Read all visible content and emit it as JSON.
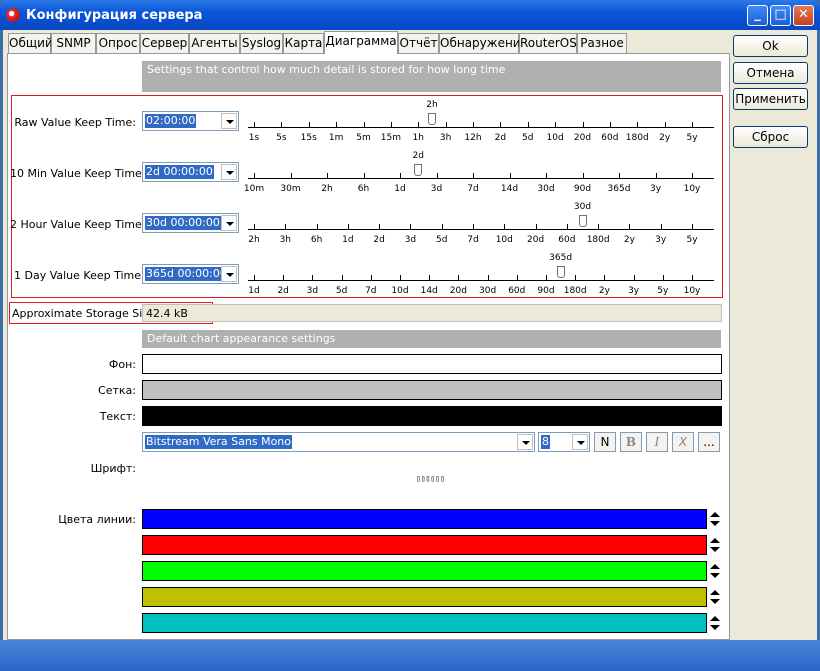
{
  "window": {
    "title": "Конфигурация сервера",
    "minimize": "_",
    "maximize": "□",
    "close": "✕"
  },
  "tabs": [
    "Общий",
    "SNMP",
    "Опрос",
    "Сервер",
    "Агенты",
    "Syslog",
    "Карта",
    "Диаграмма",
    "Отчёт",
    "Обнаружение",
    "RouterOS",
    "Разное"
  ],
  "active_tab": "Диаграмма",
  "buttons": {
    "ok": "Ok",
    "cancel": "Отмена",
    "apply": "Применить",
    "reset": "Сброс"
  },
  "retention": {
    "header": "Settings that control how much detail is stored for how long time",
    "rows": [
      {
        "label": "Raw Value Keep Time:",
        "value": "02:00:00",
        "thumb_label": "2h",
        "thumb_index": 7,
        "ticks": [
          "1s",
          "5s",
          "15s",
          "1m",
          "5m",
          "15m",
          "1h",
          "3h",
          "12h",
          "2d",
          "5d",
          "10d",
          "20d",
          "60d",
          "180d",
          "2y",
          "5y"
        ]
      },
      {
        "label": "10 Min Value Keep Time:",
        "value": "2d 00:00:00",
        "thumb_label": "2d",
        "thumb_index": 5,
        "ticks": [
          "10m",
          "30m",
          "2h",
          "6h",
          "1d",
          "3d",
          "7d",
          "14d",
          "30d",
          "90d",
          "365d",
          "3y",
          "10y"
        ]
      },
      {
        "label": "2 Hour Value Keep Time:",
        "value": "30d 00:00:00",
        "thumb_label": "30d",
        "thumb_index": 11,
        "ticks": [
          "2h",
          "3h",
          "6h",
          "1d",
          "2d",
          "3d",
          "5d",
          "7d",
          "10d",
          "20d",
          "60d",
          "180d",
          "2y",
          "3y",
          "5y"
        ]
      },
      {
        "label": "1 Day Value Keep Time:",
        "value": "365d 00:00:00",
        "thumb_label": "365d",
        "thumb_index": 11,
        "ticks": [
          "1d",
          "2d",
          "3d",
          "5d",
          "7d",
          "10d",
          "14d",
          "20d",
          "30d",
          "60d",
          "90d",
          "180d",
          "2y",
          "3y",
          "5y",
          "10y"
        ]
      }
    ]
  },
  "storage": {
    "label": "Approximate Storage Size:",
    "value": "42.4 kB"
  },
  "appearance": {
    "header": "Default chart appearance settings",
    "background_label": "Фон:",
    "grid_label": "Сетка:",
    "text_label": "Текст:",
    "font_label": "Шрифт:",
    "font_name": "Bitstream Vera Sans Mono",
    "font_size": "8",
    "font_buttons": [
      "N",
      "B",
      "I",
      "X",
      "..."
    ],
    "font_preview": "▯▯▯▯▯▯",
    "line_colors_label": "Цвета линии:",
    "colors": {
      "background": "#ffffff",
      "grid": "#c0c0c0",
      "text": "#000000"
    },
    "line_colors": [
      "#0000ff",
      "#ff0000",
      "#00ff00",
      "#c0c000",
      "#00c0c0"
    ]
  }
}
